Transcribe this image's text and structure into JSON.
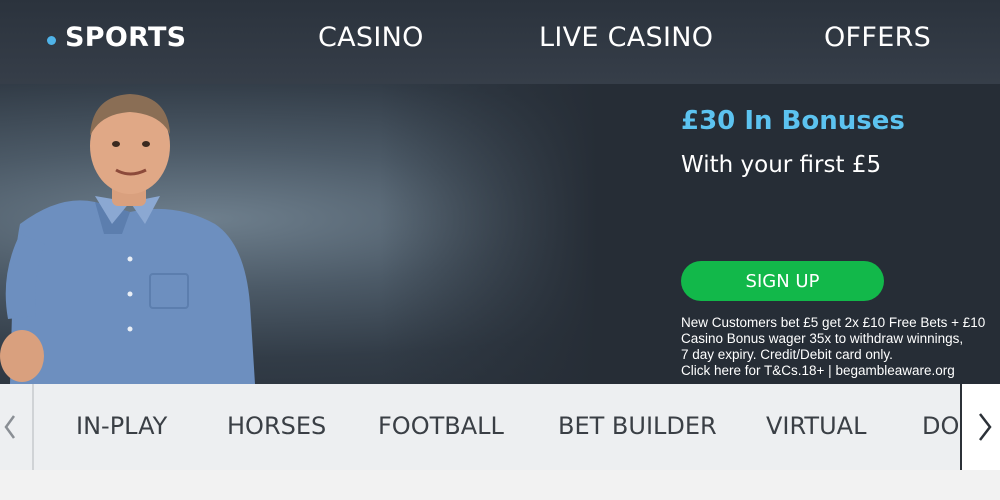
{
  "topnav": {
    "items": [
      {
        "label": "SPORTS",
        "active": true
      },
      {
        "label": "CASINO"
      },
      {
        "label": "LIVE CASINO"
      },
      {
        "label": "OFFERS"
      }
    ],
    "active_indicator_color": "#4fb3e8"
  },
  "hero": {
    "title": "£30 In Bonuses",
    "subtitle": "With your first £5",
    "cta_label": "SIGN UP",
    "cta_color": "#12b84a",
    "title_color": "#5cc3f0",
    "terms": [
      "New Customers bet £5 get 2x £10 Free Bets + £10",
      "Casino Bonus wager 35x to withdraw winnings,",
      "7 day expiry. Credit/Debit card only.",
      "Click here for T&Cs.18+ | begambleaware.org"
    ]
  },
  "subnav": {
    "items": [
      {
        "label": "IN-PLAY"
      },
      {
        "label": "HORSES"
      },
      {
        "label": "FOOTBALL"
      },
      {
        "label": "BET BUILDER"
      },
      {
        "label": "VIRTUAL"
      },
      {
        "label": "DOGS"
      }
    ],
    "left_arrow_icon": "chevron-left-icon",
    "right_arrow_icon": "chevron-right-icon"
  }
}
